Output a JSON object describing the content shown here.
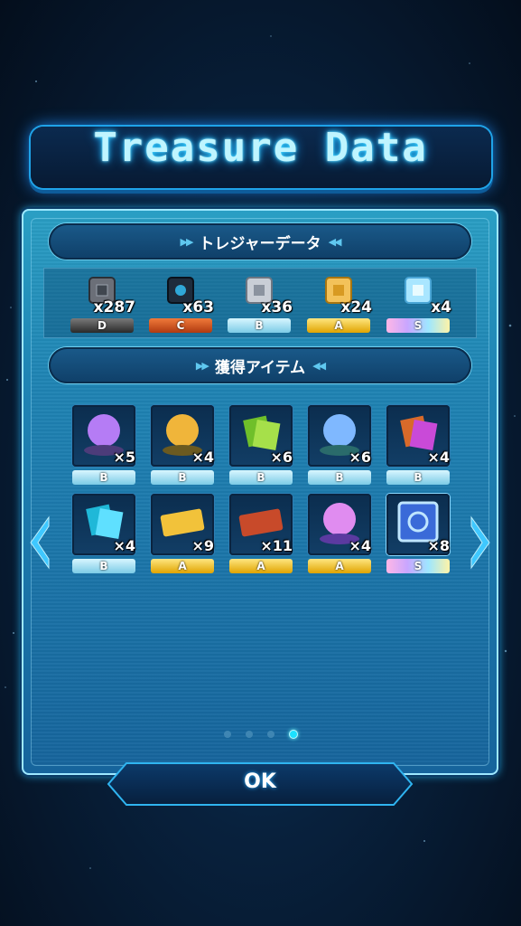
{
  "title": "Treasure Data",
  "treasure_section": {
    "header": "トレジャーデータ"
  },
  "treasure_data": [
    {
      "count": "x287",
      "grade": "D",
      "color": "#6b6f78"
    },
    {
      "count": "x63",
      "grade": "C",
      "color": "#1e2c3c"
    },
    {
      "count": "x36",
      "grade": "B",
      "color": "#c9ced6"
    },
    {
      "count": "x24",
      "grade": "A",
      "color": "#f3c25a"
    },
    {
      "count": "x4",
      "grade": "S",
      "color": "#a9e6ff"
    }
  ],
  "items_section": {
    "header": "獲得アイテム"
  },
  "items": [
    {
      "icon": "purple-orb-icon",
      "count": "×5",
      "grade": "B"
    },
    {
      "icon": "gold-orb-icon",
      "count": "×4",
      "grade": "B"
    },
    {
      "icon": "green-cards-icon",
      "count": "×6",
      "grade": "B"
    },
    {
      "icon": "blue-orb-icon",
      "count": "×6",
      "grade": "B"
    },
    {
      "icon": "rainbow-cards-icon",
      "count": "×4",
      "grade": "B"
    },
    {
      "icon": "cyan-cards-icon",
      "count": "×4",
      "grade": "B"
    },
    {
      "icon": "gold-ticket-icon",
      "count": "×9",
      "grade": "A"
    },
    {
      "icon": "red-ticket-icon",
      "count": "×11",
      "grade": "A"
    },
    {
      "icon": "pink-orb-icon",
      "count": "×4",
      "grade": "A"
    },
    {
      "icon": "s-frame-icon",
      "count": "×8",
      "grade": "S"
    }
  ],
  "pagination": {
    "total": 4,
    "active": 4
  },
  "ok_button": {
    "label": "OK"
  },
  "colors": {
    "accent": "#1fa3e8",
    "panel": "#1f84b4",
    "glow": "#2fd4ff"
  }
}
